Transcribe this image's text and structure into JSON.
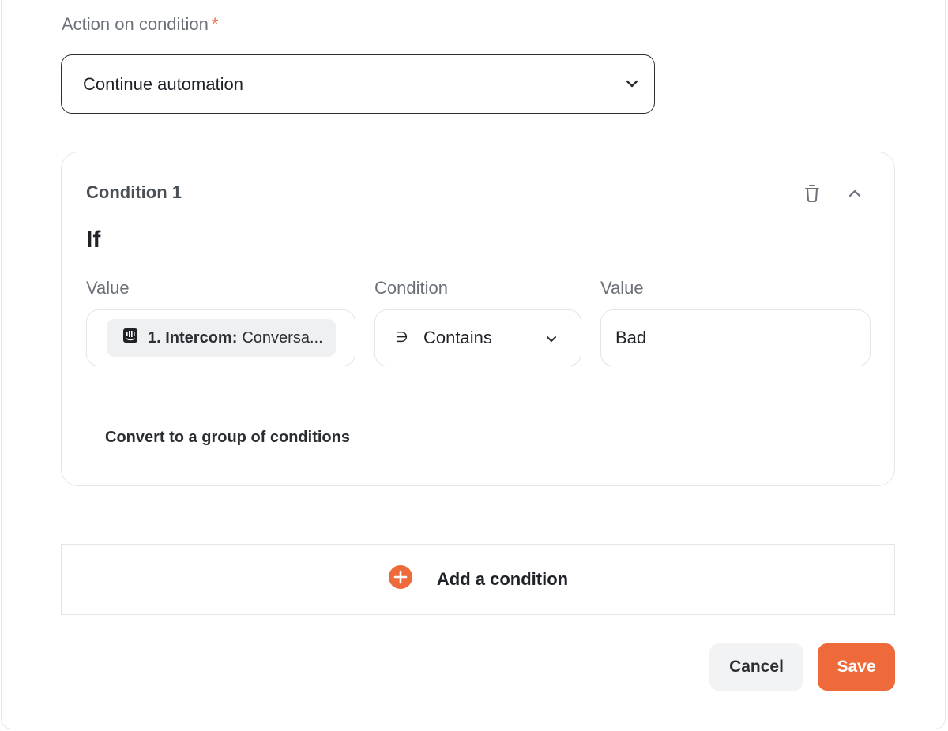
{
  "action_field": {
    "label": "Action on condition",
    "required_marker": "*",
    "selected_value": "Continue automation",
    "icon": "chevron-down-icon"
  },
  "condition_card": {
    "title": "Condition 1",
    "if_label": "If",
    "columns": {
      "value_left_label": "Value",
      "condition_label": "Condition",
      "value_right_label": "Value"
    },
    "left_value": {
      "app_prefix": "1. Intercom:",
      "field_text": "Conversa...",
      "icon": "intercom-icon"
    },
    "operator": {
      "symbol": "∋",
      "text": "Contains"
    },
    "right_value": "Bad",
    "convert_link": "Convert to a group of conditions",
    "icons": [
      "trash-icon",
      "chevron-up-icon"
    ]
  },
  "add_condition": {
    "label": "Add a condition",
    "icon": "plus-circle-icon"
  },
  "footer": {
    "cancel_label": "Cancel",
    "save_label": "Save"
  },
  "colors": {
    "accent": "#ef6a3a",
    "border": "#e3e5e8",
    "text": "#1f2328",
    "muted": "#6b7079"
  }
}
